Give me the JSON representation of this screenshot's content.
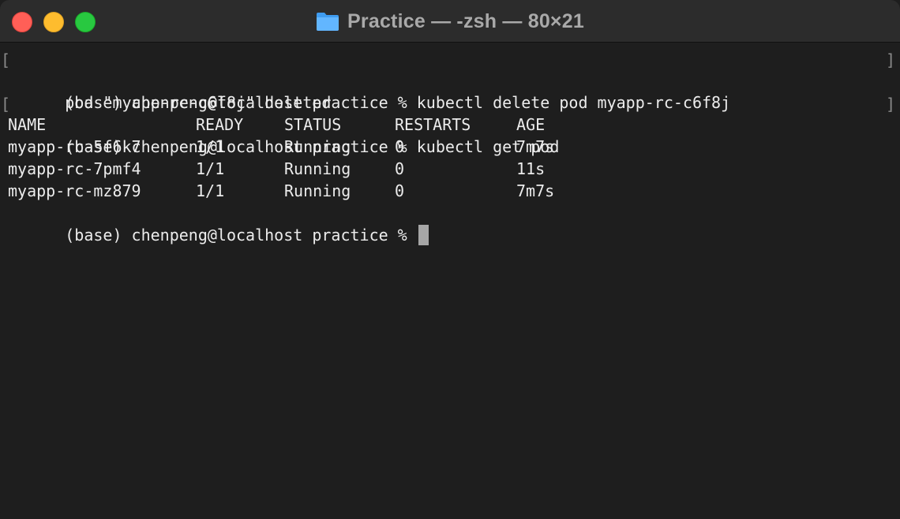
{
  "window": {
    "title": "Practice — -zsh — 80×21",
    "folder_icon": "folder-icon",
    "traffic_lights": {
      "close_color": "#ff5f57",
      "minimize_color": "#febc2e",
      "zoom_color": "#28c840"
    }
  },
  "terminal": {
    "colors": {
      "background": "#1e1e1e",
      "text": "#ececec",
      "cursor": "#a6a6a6"
    },
    "lines": [
      "(base) chenpeng@localhost practice % kubectl delete pod myapp-rc-c6f8j",
      "pod \"myapp-rc-c6f8j\" deleted",
      "(base) chenpeng@localhost practice % kubectl get pod"
    ],
    "table": {
      "headers": [
        "NAME",
        "READY",
        "STATUS",
        "RESTARTS",
        "AGE"
      ],
      "rows": [
        [
          "myapp-rc-5f6k7",
          "1/1",
          "Running",
          "0",
          "7m7s"
        ],
        [
          "myapp-rc-7pmf4",
          "1/1",
          "Running",
          "0",
          "11s"
        ],
        [
          "myapp-rc-mz879",
          "1/1",
          "Running",
          "0",
          "7m7s"
        ]
      ]
    },
    "prompt": "(base) chenpeng@localhost practice %",
    "mark_left": "[",
    "mark_right": "]"
  }
}
